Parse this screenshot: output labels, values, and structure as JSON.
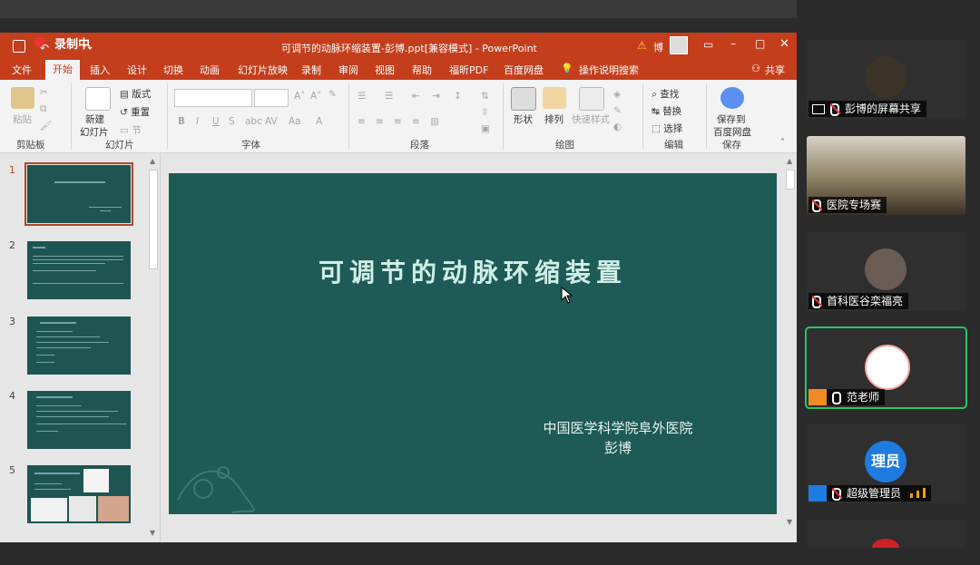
{
  "window": {
    "recording_label": "录制中",
    "title": "可调节的动脉环缩装置-彭博.ppt[兼容模式]  -  PowerPoint",
    "user": "博"
  },
  "tabs": [
    "文件",
    "开始",
    "插入",
    "设计",
    "切换",
    "动画",
    "幻灯片放映",
    "录制",
    "审阅",
    "视图",
    "帮助",
    "福昕PDF",
    "百度网盘",
    "操作说明搜索"
  ],
  "share_label": "共享",
  "ribbon": {
    "clipboard": {
      "paste": "粘贴",
      "label": "剪贴板"
    },
    "slides": {
      "new_slide": "新建",
      "new_slide2": "幻灯片",
      "layout": "版式",
      "reset": "重置",
      "section": "节",
      "label": "幻灯片"
    },
    "font": {
      "label": "字体"
    },
    "paragraph": {
      "label": "段落"
    },
    "drawing": {
      "shape": "形状",
      "arrange": "排列",
      "quick_style": "快速样式",
      "label": "绘图"
    },
    "editing": {
      "find": "查找",
      "replace": "替换",
      "select": "选择",
      "label": "编辑"
    },
    "save": {
      "line1": "保存到",
      "line2": "百度网盘",
      "label": "保存"
    }
  },
  "thumbnails": [
    "1",
    "2",
    "3",
    "4",
    "5"
  ],
  "slide": {
    "title": "可调节的动脉环缩装置",
    "institution": "中国医学科学院阜外医院",
    "author": "彭博"
  },
  "participants": [
    {
      "name": "彭博的屏幕共享",
      "muted": true
    },
    {
      "name": "医院专场赛",
      "muted": true
    },
    {
      "name": "首科医谷栾福亮",
      "muted": true
    },
    {
      "name": "范老师",
      "muted": false
    },
    {
      "name": "超级管理员",
      "avatar_text": "理员",
      "muted": true
    }
  ],
  "colors": {
    "ppt_red": "#c43e1c",
    "slide_bg": "#1e5a56",
    "active_border": "#2ec36b",
    "avatar_blue": "#1e7be0"
  }
}
